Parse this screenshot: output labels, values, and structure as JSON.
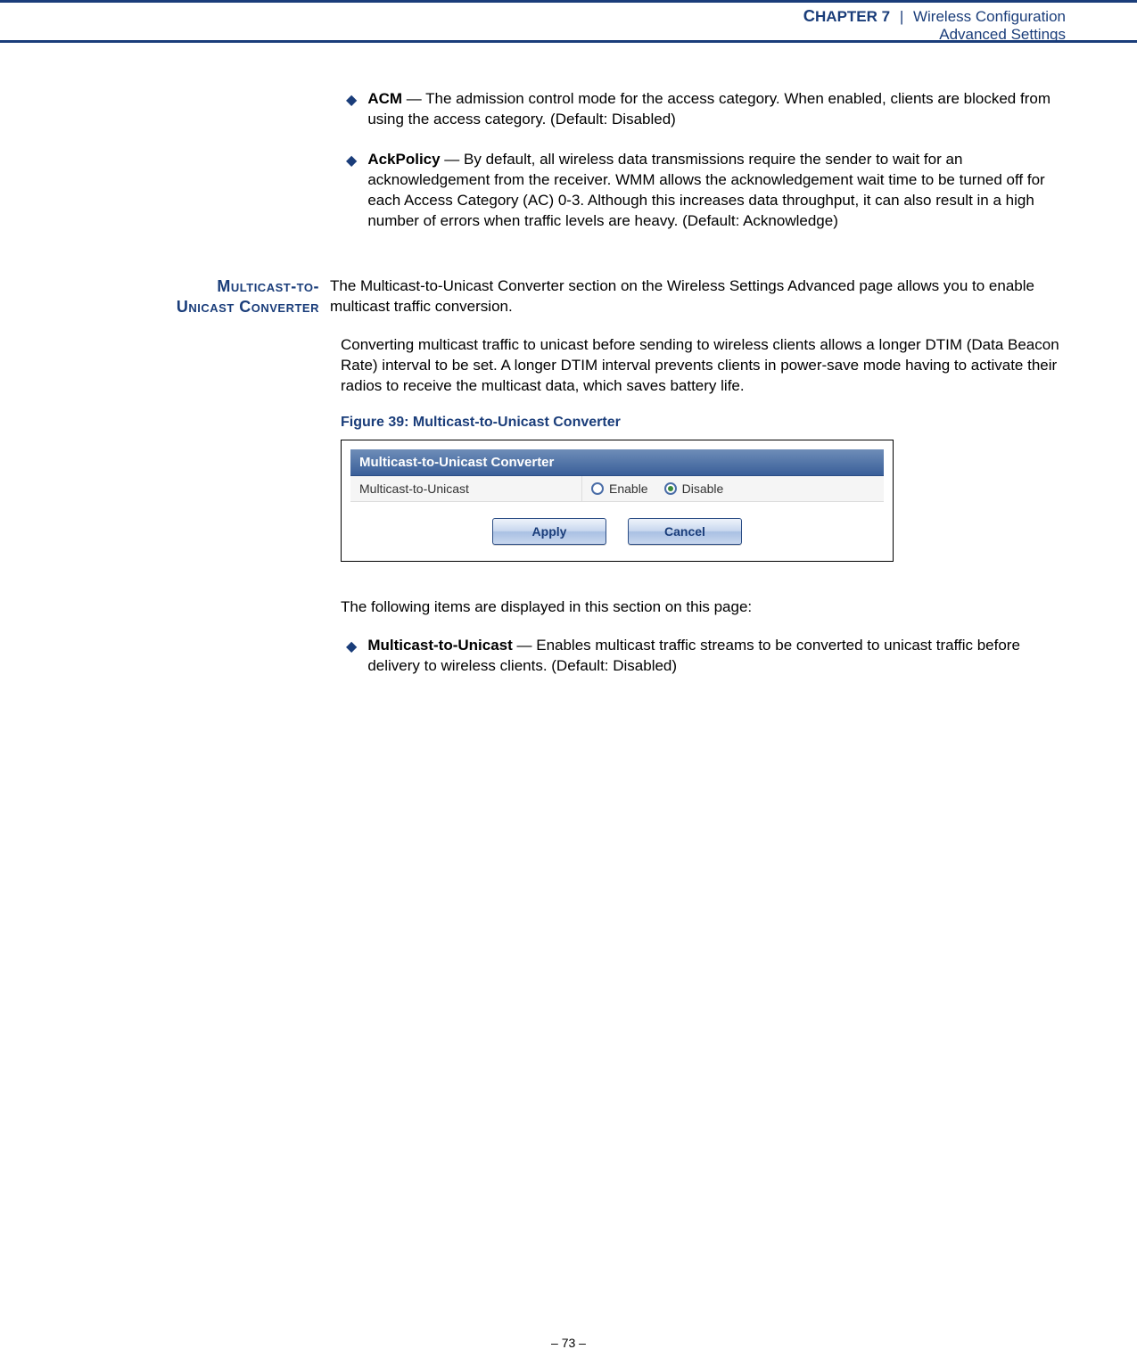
{
  "header": {
    "chapter": "Chapter 7",
    "sep": "|",
    "title1": "Wireless Configuration",
    "title2": "Advanced Settings"
  },
  "bullets_top": [
    {
      "term": "ACM",
      "text": " — The admission control mode for the access category. When enabled, clients are blocked from using the access category. (Default: Disabled)"
    },
    {
      "term": "AckPolicy",
      "text": " — By default, all wireless data transmissions require the sender to wait for an acknowledgement from the receiver. WMM allows the acknowledgement wait time to be turned off for each Access Category (AC) 0-3. Although this increases data throughput, it can also result in a high number of errors when traffic levels are heavy. (Default: Acknowledge)"
    }
  ],
  "section": {
    "label_l1": "Multicast-to-",
    "label_l2": "Unicast Converter",
    "intro": "The Multicast-to-Unicast Converter section on the Wireless Settings Advanced page allows you to enable multicast traffic conversion."
  },
  "para2": "Converting multicast traffic to unicast before sending to wireless clients allows a longer DTIM (Data Beacon Rate) interval to be set. A longer DTIM interval prevents clients in power-save mode having to activate their radios to receive the multicast data, which saves battery life.",
  "figure": {
    "caption": "Figure 39:  Multicast-to-Unicast Converter",
    "panel_title": "Multicast-to-Unicast Converter",
    "row_label": "Multicast-to-Unicast",
    "opt_enable": "Enable",
    "opt_disable": "Disable",
    "btn_apply": "Apply",
    "btn_cancel": "Cancel"
  },
  "post_figure": "The following items are displayed in this section on this page:",
  "bullets_bottom": [
    {
      "term": "Multicast-to-Unicast",
      "text": " — Enables multicast traffic streams to be converted to unicast traffic before delivery to wireless clients. (Default: Disabled)"
    }
  ],
  "footer": "–  73  –"
}
